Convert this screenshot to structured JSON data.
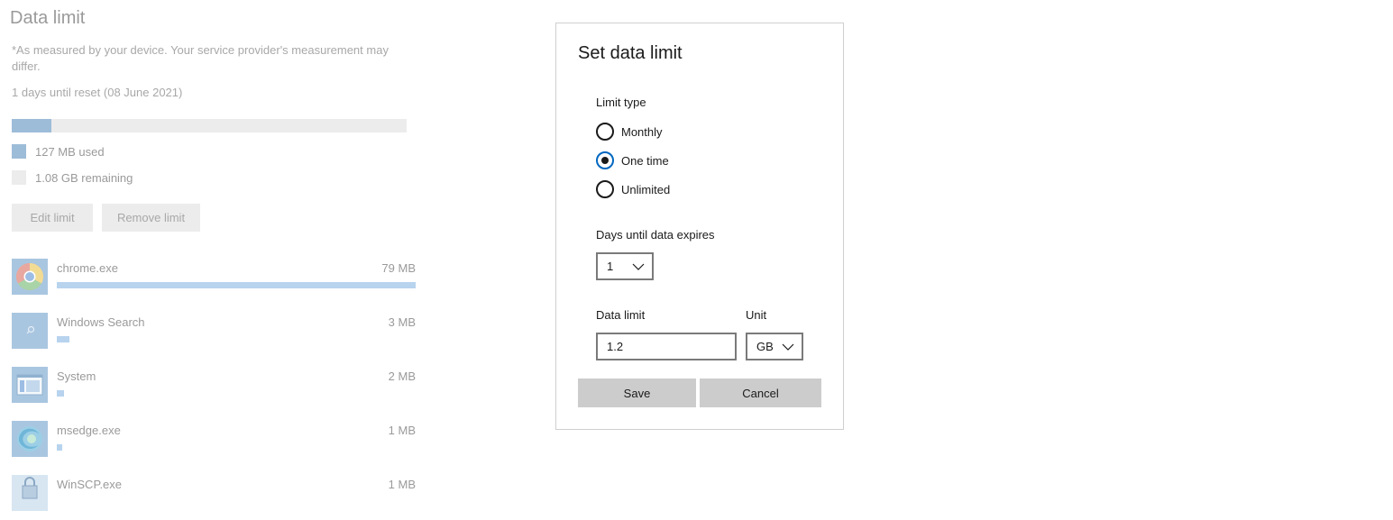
{
  "background": {
    "title": "Data limit",
    "note": "*As measured by your device. Your service provider's measurement may differ.",
    "reset_text": "1 days until reset (08 June 2021)",
    "usage_fraction": 0.1,
    "used_label": "127 MB used",
    "remaining_label": "1.08 GB remaining",
    "edit_button": "Edit limit",
    "remove_button": "Remove limit",
    "apps": [
      {
        "name": "chrome.exe",
        "size": "79 MB",
        "icon": "chrome-icon",
        "fraction": 1.0
      },
      {
        "name": "Windows Search",
        "size": "3 MB",
        "icon": "search-icon",
        "fraction": 0.035
      },
      {
        "name": "System",
        "size": "2 MB",
        "icon": "system-window-icon",
        "fraction": 0.02
      },
      {
        "name": "msedge.exe",
        "size": "1 MB",
        "icon": "edge-icon",
        "fraction": 0.015
      },
      {
        "name": "WinSCP.exe",
        "size": "1 MB",
        "icon": "winscp-icon",
        "fraction": 0.015
      }
    ],
    "colors": {
      "used": "#9dbcd8",
      "remaining": "#ececec",
      "app_bar": "#b7d3ee"
    }
  },
  "dialog": {
    "title": "Set data limit",
    "limit_type_label": "Limit type",
    "options": [
      {
        "label": "Monthly",
        "selected": false
      },
      {
        "label": "One time",
        "selected": true
      },
      {
        "label": "Unlimited",
        "selected": false
      }
    ],
    "days_label": "Days until data expires",
    "days_value": "1",
    "data_limit_label": "Data limit",
    "data_limit_value": "1.2",
    "unit_label": "Unit",
    "unit_value": "GB",
    "save_button": "Save",
    "cancel_button": "Cancel",
    "accent_color": "#0067c0"
  }
}
